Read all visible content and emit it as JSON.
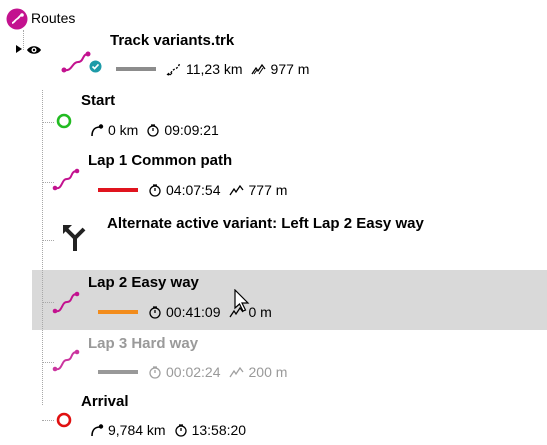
{
  "root": {
    "label": "Routes",
    "icon": "route-icon"
  },
  "track": {
    "title": "Track variants.trk",
    "distance": "11,23 km",
    "elevation": "977 m",
    "line_color": "#8c8c8c",
    "icons": [
      "eye-icon",
      "route-icon",
      "check-badge-icon"
    ]
  },
  "items": [
    {
      "type": "start",
      "title": "Start",
      "distance": "0 km",
      "time": "09:09:21",
      "icon": "start-circle-icon",
      "color": "#22bb22"
    },
    {
      "type": "lap",
      "title": "Lap 1  Common path",
      "time": "04:07:54",
      "elevation": "777 m",
      "line_color": "#e0141e",
      "icon": "route-icon"
    },
    {
      "type": "variant",
      "title": "Alternate active variant: Left Lap 2  Easy way",
      "icon": "fork-arrow-icon"
    },
    {
      "type": "lap",
      "title": "Lap 2  Easy way",
      "time": "00:41:09",
      "elevation": "0 m",
      "line_color": "#f28c1c",
      "icon": "route-icon",
      "selected": true
    },
    {
      "type": "lap",
      "title": "Lap 3  Hard way",
      "time": "00:02:24",
      "elevation": "200 m",
      "line_color": "#999999",
      "icon": "route-icon",
      "inactive": true
    },
    {
      "type": "arrival",
      "title": "Arrival",
      "distance": "9,784 km",
      "time": "13:58:20",
      "icon": "arrival-circle-icon",
      "color": "#e01010"
    }
  ],
  "colors": {
    "accent": "#c3128f",
    "selection": "#d9d9d9",
    "tree_lines": "#a8a8a8"
  }
}
